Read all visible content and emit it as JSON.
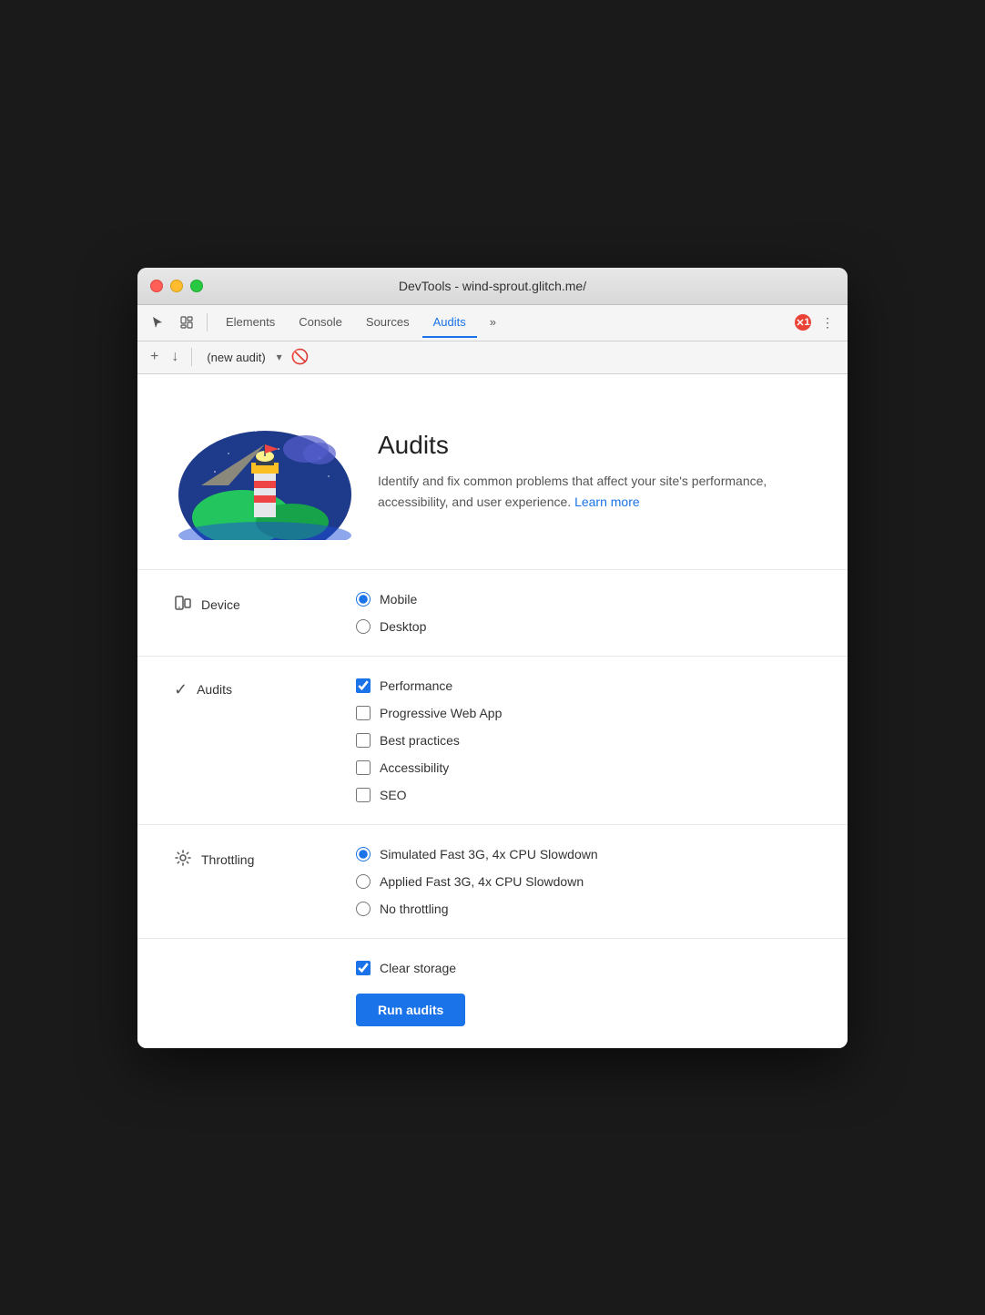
{
  "window": {
    "title": "DevTools - wind-sprout.glitch.me/"
  },
  "titlebar": {
    "title": "DevTools - wind-sprout.glitch.me/"
  },
  "toolbar": {
    "tabs": [
      {
        "id": "elements",
        "label": "Elements",
        "active": false
      },
      {
        "id": "console",
        "label": "Console",
        "active": false
      },
      {
        "id": "sources",
        "label": "Sources",
        "active": false
      },
      {
        "id": "audits",
        "label": "Audits",
        "active": true
      },
      {
        "id": "more",
        "label": "»",
        "active": false
      }
    ],
    "error_count": "1",
    "more_menu": "⋮"
  },
  "toolbar2": {
    "add_label": "+",
    "download_label": "↓",
    "audit_name": "(new audit)",
    "delete_label": "🚫"
  },
  "hero": {
    "title": "Audits",
    "description": "Identify and fix common problems that affect your site's performance, accessibility, and user experience.",
    "learn_more": "Learn more"
  },
  "device_section": {
    "label": "Device",
    "options": [
      {
        "id": "mobile",
        "label": "Mobile",
        "checked": true
      },
      {
        "id": "desktop",
        "label": "Desktop",
        "checked": false
      }
    ]
  },
  "audits_section": {
    "label": "Audits",
    "options": [
      {
        "id": "performance",
        "label": "Performance",
        "checked": true
      },
      {
        "id": "pwa",
        "label": "Progressive Web App",
        "checked": false
      },
      {
        "id": "best-practices",
        "label": "Best practices",
        "checked": false
      },
      {
        "id": "accessibility",
        "label": "Accessibility",
        "checked": false
      },
      {
        "id": "seo",
        "label": "SEO",
        "checked": false
      }
    ]
  },
  "throttling_section": {
    "label": "Throttling",
    "options": [
      {
        "id": "simulated",
        "label": "Simulated Fast 3G, 4x CPU Slowdown",
        "checked": true
      },
      {
        "id": "applied",
        "label": "Applied Fast 3G, 4x CPU Slowdown",
        "checked": false
      },
      {
        "id": "none",
        "label": "No throttling",
        "checked": false
      }
    ]
  },
  "bottom": {
    "clear_storage_label": "Clear storage",
    "clear_storage_checked": true,
    "run_button": "Run audits"
  }
}
